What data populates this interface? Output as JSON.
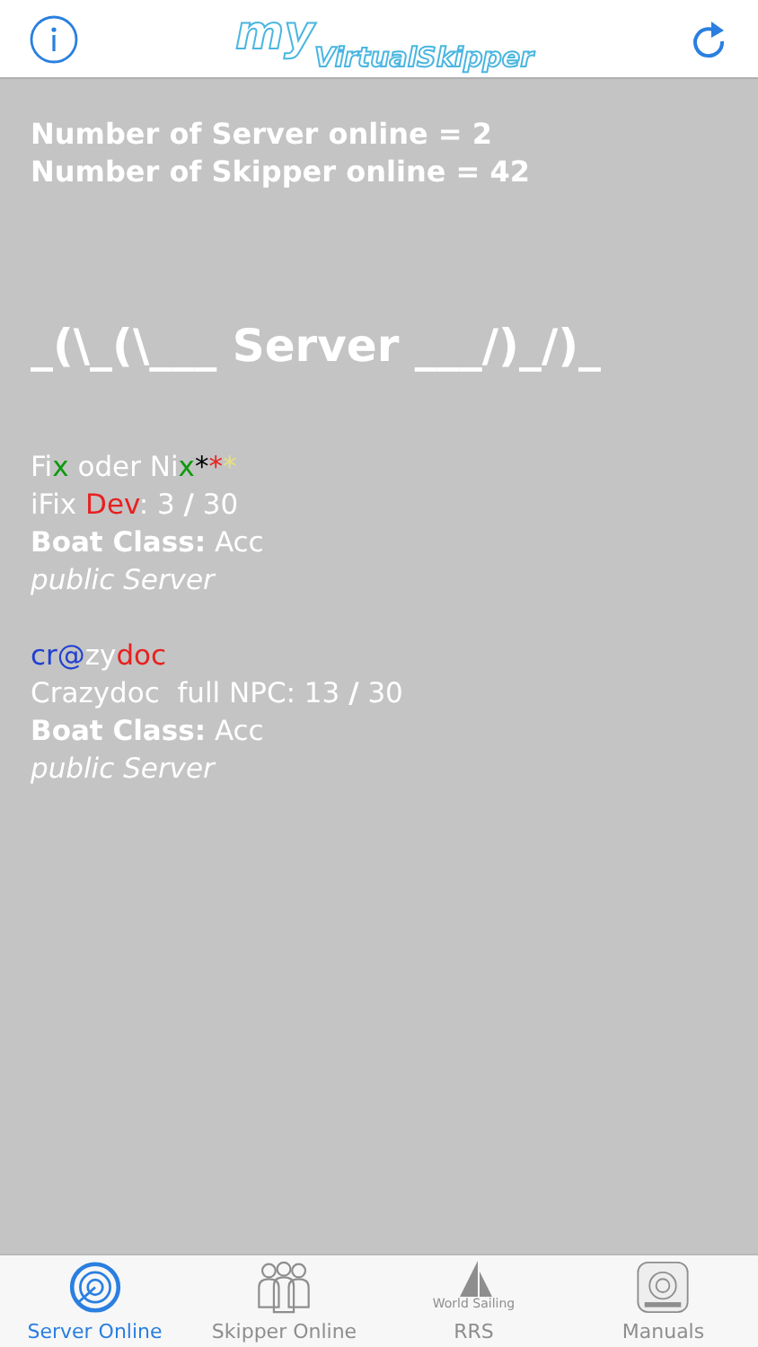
{
  "header": {
    "logo_top": "my",
    "logo_bottom": "VirtualSkipper"
  },
  "stats": [
    "Number of Server online = 2",
    "Number of Skipper online = 42"
  ],
  "banner": "_(\\_(\\___ Server ___/)_/)_",
  "servers": [
    {
      "name": [
        {
          "text": "Fi",
          "color": "#ffffff"
        },
        {
          "text": "x",
          "color": "#0c9a0c"
        },
        {
          "text": " oder Ni",
          "color": "#ffffff"
        },
        {
          "text": "x",
          "color": "#0c9a0c"
        },
        {
          "text": "*",
          "color": "#000000"
        },
        {
          "text": "*",
          "color": "#e82020"
        },
        {
          "text": "*",
          "color": "#e8e080"
        }
      ],
      "info": [
        {
          "text": "iFix ",
          "color": "#ffffff"
        },
        {
          "text": "Dev",
          "color": "#e82020"
        },
        {
          "text": ": 3 ",
          "color": "#ffffff"
        },
        {
          "text": "/",
          "color": "#ffffff",
          "bold": true
        },
        {
          "text": " 30",
          "color": "#ffffff"
        }
      ],
      "class_label": "Boat Class:",
      "class_value": "Acc",
      "access": "public Server"
    },
    {
      "name": [
        {
          "text": "cr@",
          "color": "#2040d0"
        },
        {
          "text": "zy",
          "color": "#ffffff"
        },
        {
          "text": "doc",
          "color": "#e82020"
        }
      ],
      "info": [
        {
          "text": "Crazydoc  full NPC: 13 ",
          "color": "#ffffff"
        },
        {
          "text": "/",
          "color": "#ffffff",
          "bold": true
        },
        {
          "text": " 30",
          "color": "#ffffff"
        }
      ],
      "class_label": "Boat Class:",
      "class_value": "Acc",
      "access": "public Server"
    }
  ],
  "tabs": [
    {
      "label": "Server Online",
      "kind": "radar",
      "selected": true
    },
    {
      "label": "Skipper Online",
      "kind": "people",
      "selected": false
    },
    {
      "label": "RRS",
      "kind": "sail",
      "icon_text": "World Sailing",
      "selected": false
    },
    {
      "label": "Manuals",
      "kind": "app",
      "selected": false
    }
  ]
}
